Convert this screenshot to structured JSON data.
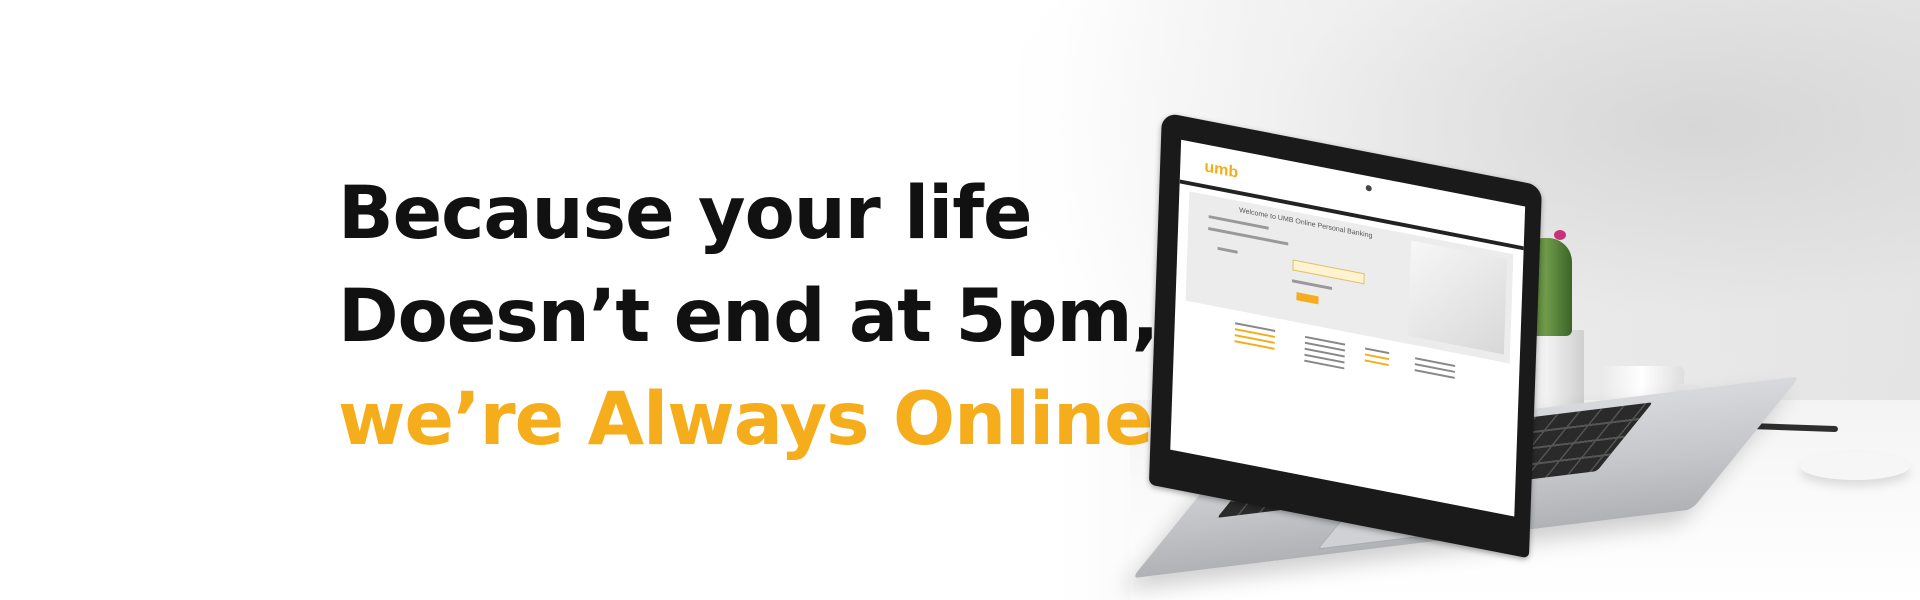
{
  "banner": {
    "headline": {
      "line1": "Because your life",
      "line2": "Doesn’t end at 5pm,",
      "line3": "we’re Always Online"
    },
    "colors": {
      "text_dark": "#111111",
      "accent": "#f5ad1b",
      "background": "#ffffff"
    }
  },
  "laptop_screen": {
    "logo_text": "umb",
    "welcome_text": "Welcome to UMB Online Personal Banking"
  },
  "icons": [
    "laptop-illustration",
    "cactus-plant",
    "coffee-cup",
    "pen",
    "computer-mouse"
  ]
}
